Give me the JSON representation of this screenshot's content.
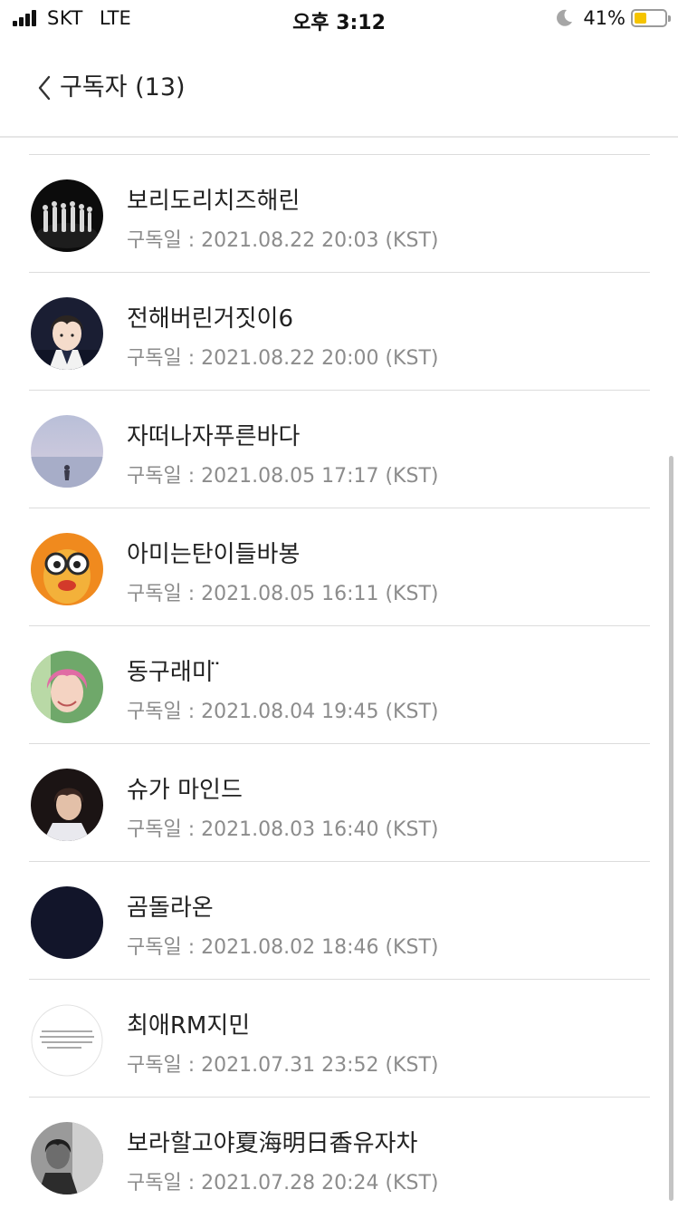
{
  "status_bar": {
    "carrier": "SKT",
    "network": "LTE",
    "time": "오후 3:12",
    "battery_percent": "41%",
    "battery_level": 0.41,
    "battery_color": "#f5c400"
  },
  "header": {
    "back_icon": "chevron-left-icon",
    "title": "구독자 (13)"
  },
  "subscribers": [
    {
      "name": "보리도리치즈해린",
      "date": "구독일 : 2021.08.22 20:03 (KST)",
      "avatar": "group-dancers-photo"
    },
    {
      "name": "전해버린거짓이6",
      "date": "구독일 : 2021.08.22 20:00 (KST)",
      "avatar": "illustrated-boy-portrait"
    },
    {
      "name": "자떠나자푸른바다",
      "date": "구독일 : 2021.08.05 17:17 (KST)",
      "avatar": "sky-silhouette-photo"
    },
    {
      "name": "아미는탄이들바봉",
      "date": "구독일 : 2021.08.05 16:11 (KST)",
      "avatar": "glasses-filter-face"
    },
    {
      "name": "동구래미 ̈",
      "date": "구독일 : 2021.08.04 19:45 (KST)",
      "avatar": "pink-hair-portrait"
    },
    {
      "name": "슈가  마인드",
      "date": "구독일 : 2021.08.03 16:40 (KST)",
      "avatar": "dark-portrait-photo"
    },
    {
      "name": "곰돌라온",
      "date": "구독일 : 2021.08.02 18:46 (KST)",
      "avatar": "dark-navy-image"
    },
    {
      "name": "최애RM지민",
      "date": "구독일 : 2021.07.31 23:52 (KST)",
      "avatar": "text-note-image"
    },
    {
      "name": "보라할고야夏海明日香유자차",
      "date": "구독일 : 2021.07.28 20:24 (KST)",
      "avatar": "monochrome-portrait"
    }
  ]
}
